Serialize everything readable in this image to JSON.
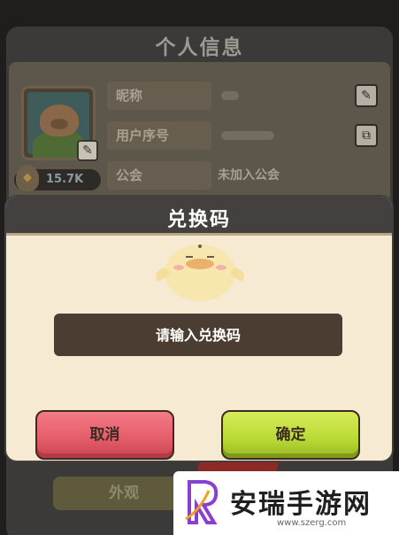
{
  "profile": {
    "title": "个人信息",
    "power_value": "15.7K",
    "rows": [
      {
        "label": "昵称",
        "value": ""
      },
      {
        "label": "用户序号",
        "value": ""
      },
      {
        "label": "公会",
        "value": "未加入公会"
      }
    ],
    "appearance_tab": "外观"
  },
  "dialog": {
    "title": "兑换码",
    "input_placeholder": "请输入兑换码",
    "cancel_label": "取消",
    "confirm_label": "确定"
  },
  "watermark": {
    "text": "安瑞手游网",
    "url": "www.szerg.com"
  },
  "colors": {
    "cancel": "#e35c68",
    "confirm": "#b9d935",
    "header": "#44403f",
    "dialog_bg": "#f6ead2"
  }
}
